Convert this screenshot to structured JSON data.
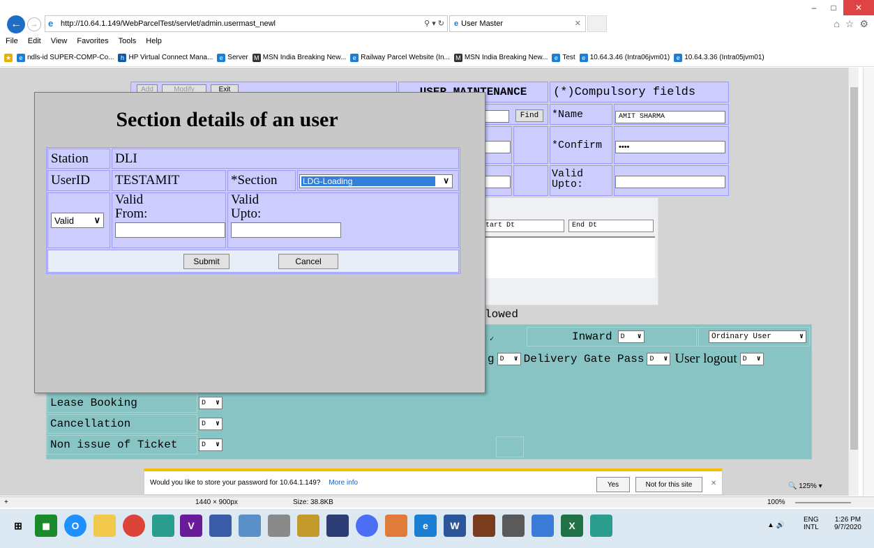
{
  "browser": {
    "url": "http://10.64.1.149/WebParcelTest/servlet/admin.usermast_newl",
    "tab_title": "User Master",
    "menu": [
      "File",
      "Edit",
      "View",
      "Favorites",
      "Tools",
      "Help"
    ],
    "favorites": [
      "ndls-id SUPER-COMP-Co...",
      "HP Virtual Connect Mana...",
      "Server",
      "MSN India Breaking New...",
      "Railway Parcel Website (In...",
      "MSN India Breaking New...",
      "Test",
      "10.64.3.46 (Intra06jvm01)",
      "10.64.3.36 (Intra05jvm01)"
    ],
    "zoom": "125%"
  },
  "page": {
    "header": "USER MAINTENANCE",
    "compulsory": "(*)Compulsory fields",
    "find_label": "Find",
    "name_label": "*Name",
    "name_value": "AMIT SHARMA",
    "confirm_label": "*Confirm",
    "confirm_value": "••••",
    "valid_upto_label": "Valid\nUpto:",
    "start_dt": "tart Dt",
    "end_dt": "End Dt",
    "allowed_text": "lowed",
    "inward_label": "Inward",
    "inward_value": "D",
    "user_type": "Ordinary User",
    "g_value": "D",
    "g_label_tail": "g",
    "delivery_label": "Delivery Gate Pass",
    "delivery_value": "D",
    "logout_label": "User logout",
    "logout_value": "D",
    "lease_label": "Lease Booking",
    "lease_value": "D",
    "cancel_label": "Cancellation",
    "cancel_value": "D",
    "nonissue_label": "Non issue of Ticket",
    "nonissue_value": "D",
    "top_buttons": [
      "Add",
      "Modify",
      "Exit"
    ]
  },
  "modal": {
    "title": "Section details of an user",
    "station_label": "Station",
    "station_value": "DLI",
    "userid_label": "UserID",
    "userid_value": "TESTAMIT",
    "section_label": "*Section",
    "section_value": "LDG-Loading",
    "status_value": "Valid",
    "valid_from_label": "Valid\nFrom:",
    "valid_upto_label": "Valid\nUpto:",
    "submit": "Submit",
    "cancel": "Cancel"
  },
  "notification": {
    "text": "Would you like to store your password for 10.64.1.149?",
    "more_info": "More info",
    "yes": "Yes",
    "not_for_site": "Not for this site"
  },
  "statusbar": {
    "dims": "1440 × 900px",
    "size": "Size: 38.8KB",
    "zoom": "100%"
  },
  "taskbar": {
    "lang": "ENG",
    "lang2": "INTL",
    "time": "1:26 PM",
    "date": "9/7/2020"
  }
}
